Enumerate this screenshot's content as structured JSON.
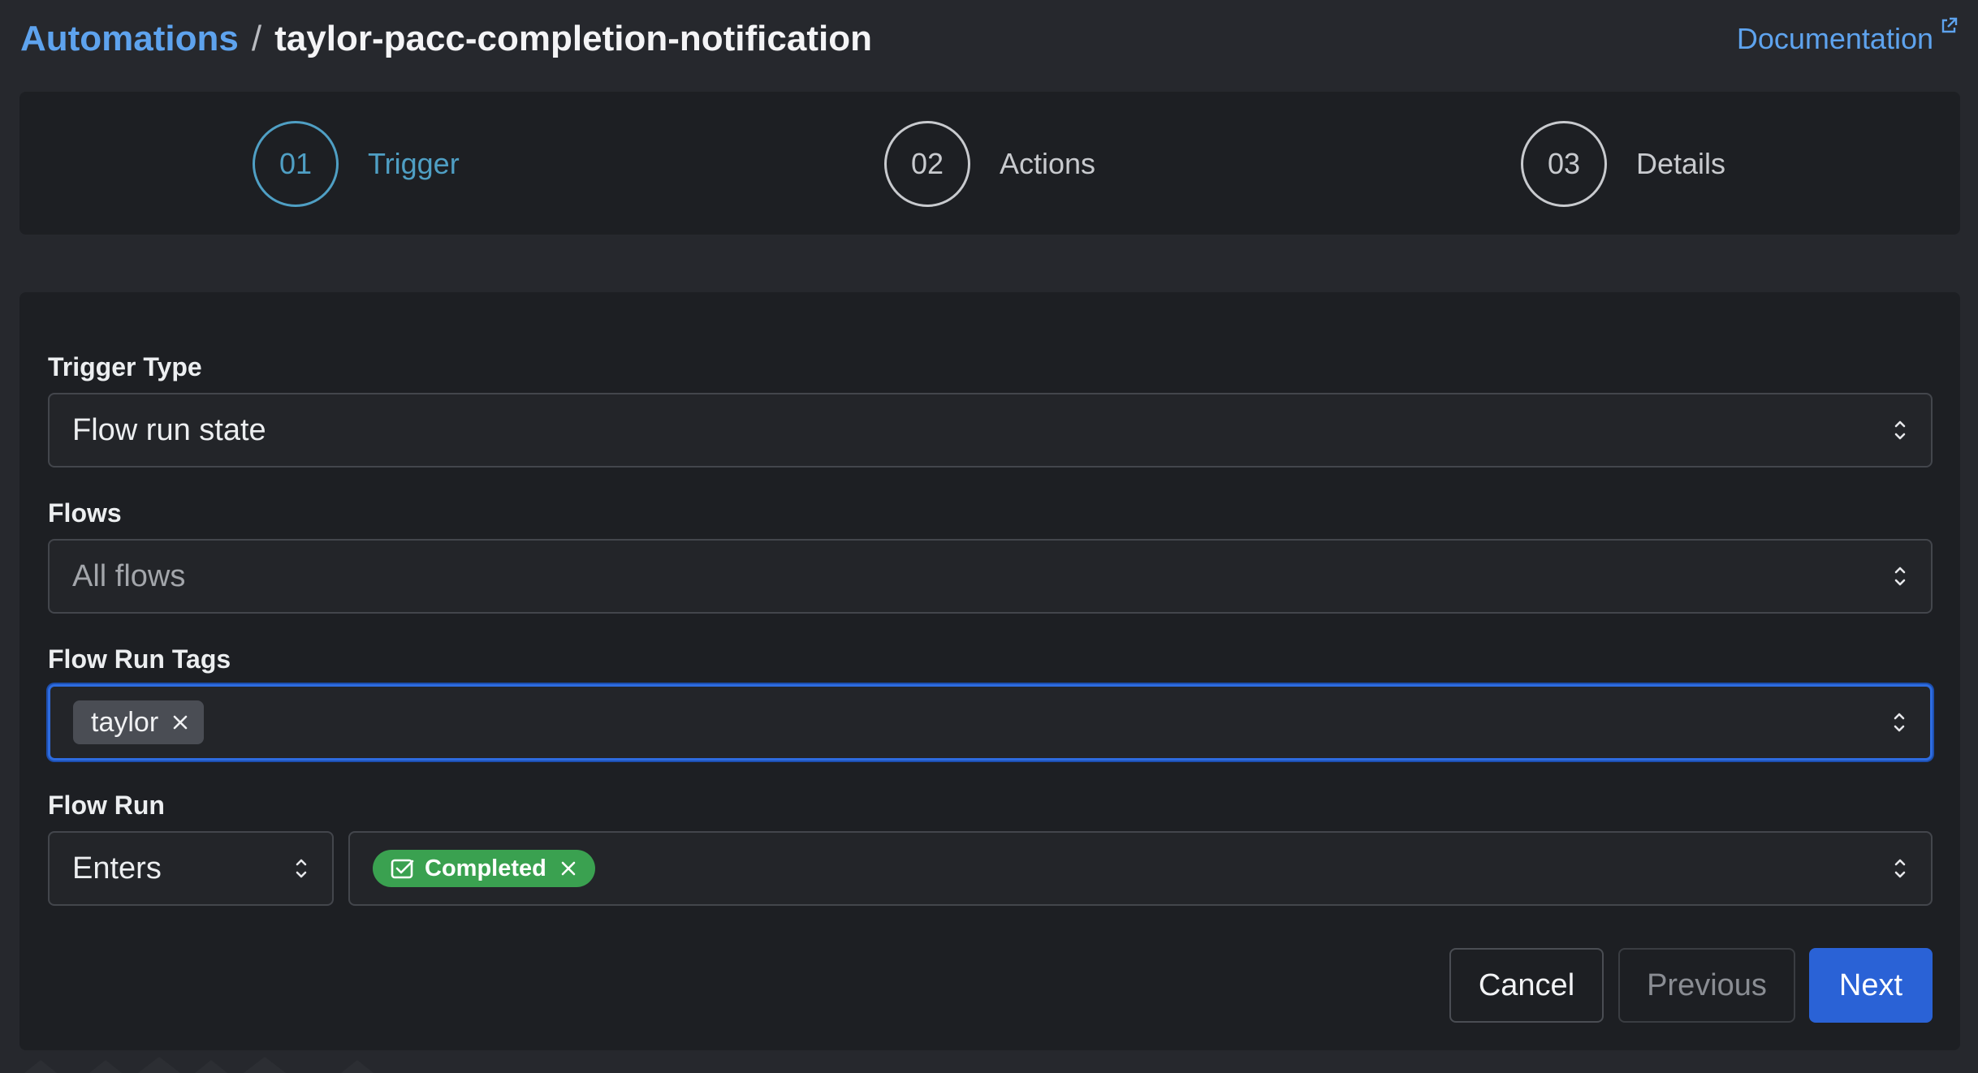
{
  "header": {
    "breadcrumb_root": "Automations",
    "separator": "/",
    "title": "taylor-pacc-completion-notification",
    "doc_link": "Documentation"
  },
  "steps": [
    {
      "number": "01",
      "label": "Trigger",
      "active": true
    },
    {
      "number": "02",
      "label": "Actions",
      "active": false
    },
    {
      "number": "03",
      "label": "Details",
      "active": false
    }
  ],
  "form": {
    "trigger_type": {
      "label": "Trigger Type",
      "value": "Flow run state"
    },
    "flows": {
      "label": "Flows",
      "placeholder": "All flows"
    },
    "flow_run_tags": {
      "label": "Flow Run Tags",
      "tags": [
        "taylor"
      ]
    },
    "flow_run": {
      "label": "Flow Run",
      "condition": "Enters",
      "states": [
        "Completed"
      ]
    }
  },
  "buttons": {
    "cancel": "Cancel",
    "previous": "Previous",
    "next": "Next"
  },
  "colors": {
    "accent_link": "#5ea3ee",
    "active_step": "#4f9fc4",
    "primary_button": "#2a62d6",
    "completed_badge": "#3aa150",
    "focus_ring": "#2e6ce0"
  }
}
